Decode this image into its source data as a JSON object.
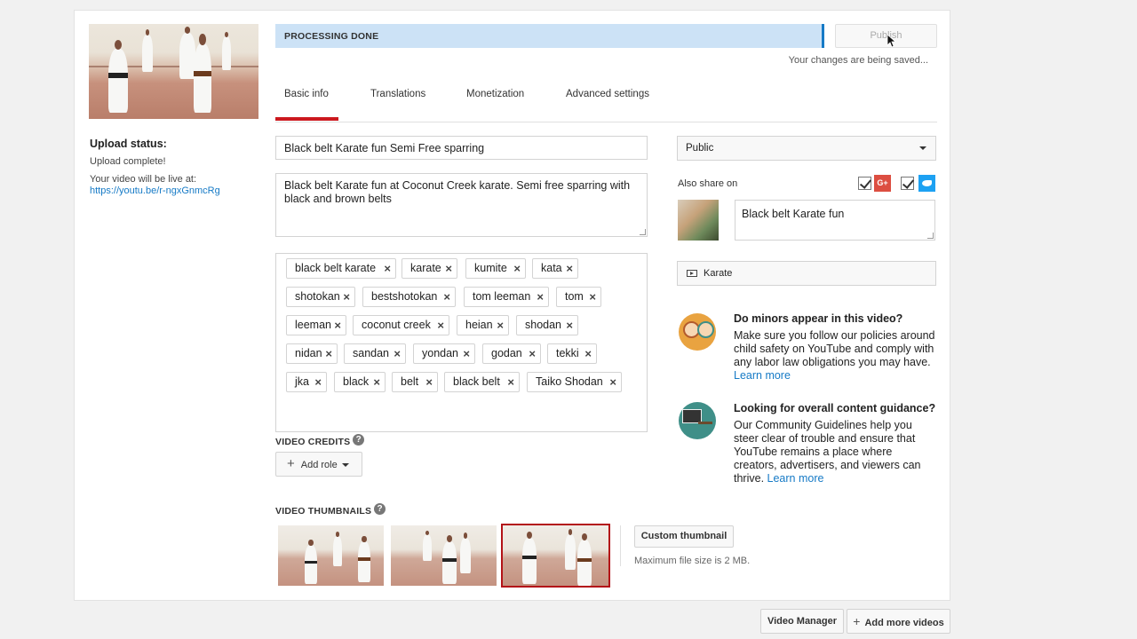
{
  "upload": {
    "status_heading": "Upload status:",
    "complete_text": "Upload complete!",
    "live_text": "Your video will be live at:",
    "url": "https://youtu.be/r-ngxGnmcRg"
  },
  "processing": {
    "label": "PROCESSING DONE",
    "progress": 1.0
  },
  "publish": {
    "label": "Publish",
    "saving_text": "Your changes are being saved..."
  },
  "tabs": [
    {
      "label": "Basic info",
      "active": true
    },
    {
      "label": "Translations",
      "active": false
    },
    {
      "label": "Monetization",
      "active": false
    },
    {
      "label": "Advanced settings",
      "active": false
    }
  ],
  "form": {
    "title": "Black belt Karate fun Semi Free sparring",
    "description": "Black belt Karate fun at Coconut Creek karate. Semi free sparring with black and brown belts",
    "tags": [
      [
        "black belt karate",
        "karate",
        "kumite",
        "kata"
      ],
      [
        "shotokan",
        "bestshotokan",
        "tom leeman",
        "tom"
      ],
      [
        "leeman",
        "coconut creek",
        "heian",
        "shodan"
      ],
      [
        "nidan",
        "sandan",
        "yondan",
        "godan",
        "tekki"
      ],
      [
        "jka",
        "black",
        "belt",
        "black belt",
        "Taiko Shodan"
      ]
    ]
  },
  "credits": {
    "label": "VIDEO CREDITS",
    "add_role_label": "Add role"
  },
  "thumbnails": {
    "label": "VIDEO THUMBNAILS",
    "selected_index": 2,
    "custom_label": "Custom thumbnail",
    "max_size_text": "Maximum file size is 2 MB."
  },
  "privacy": {
    "value": "Public"
  },
  "share": {
    "label": "Also share on",
    "google_plus_icon_text": "G+",
    "google_plus_checked": true,
    "twitter_checked": true,
    "message": "Black belt Karate fun"
  },
  "category": {
    "value": "Karate"
  },
  "info": {
    "minors_title": "Do minors appear in this video?",
    "minors_body": "Make sure you follow our policies around child safety on YouTube and comply with any labor law obligations you may have.",
    "minors_link": "Learn more",
    "guidance_title": "Looking for overall content guidance?",
    "guidance_body": "Our Community Guidelines help you steer clear of trouble and ensure that YouTube remains a place where creators, advertisers, and viewers can thrive.",
    "guidance_link": "Learn more"
  },
  "bottom": {
    "video_manager": "Video Manager",
    "add_more": "Add more videos"
  },
  "colors": {
    "accent_red": "#cc181e",
    "link_blue": "#167ac6",
    "processing_bg": "#cce2f6"
  }
}
